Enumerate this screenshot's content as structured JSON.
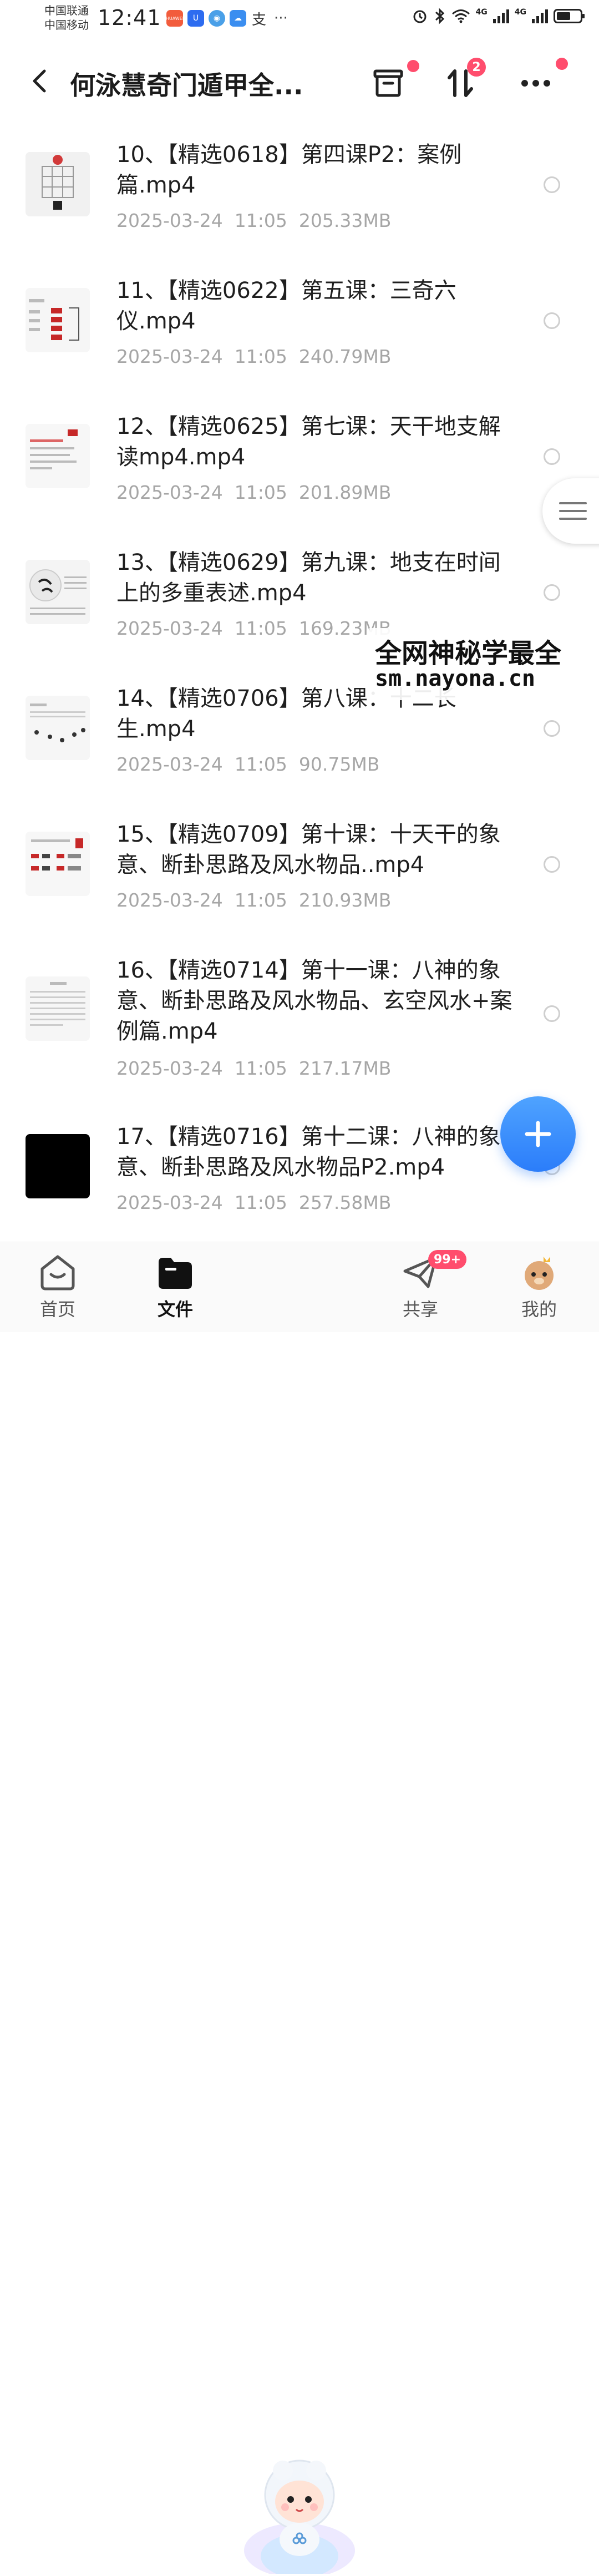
{
  "status_bar": {
    "carrier1": "中国联通",
    "carrier2": "中国移动",
    "time": "12:41",
    "app_badges": [
      "HUAWEI",
      "U",
      "◉",
      "☁",
      "支"
    ],
    "more": "···",
    "net1": "4G",
    "net2": "4G"
  },
  "header": {
    "title": "何泳慧奇门遁甲全...",
    "transfer_badge": "2"
  },
  "files": [
    {
      "name": "10、【精选0618】第四课P2：案例篇.mp4",
      "date": "2025-03-24  11:05",
      "size": "205.33MB"
    },
    {
      "name": "11、【精选0622】第五课：三奇六仪.mp4",
      "date": "2025-03-24  11:05",
      "size": "240.79MB"
    },
    {
      "name": "12、【精选0625】第七课：天干地支解读mp4.mp4",
      "date": "2025-03-24  11:05",
      "size": "201.89MB"
    },
    {
      "name": "13、【精选0629】第九课：地支在时间上的多重表述.mp4",
      "date": "2025-03-24  11:05",
      "size": "169.23MB"
    },
    {
      "name": "14、【精选0706】第八课：十二长生.mp4",
      "date": "2025-03-24  11:05",
      "size": "90.75MB"
    },
    {
      "name": "15、【精选0709】第十课：十天干的象意、断卦思路及风水物品..mp4",
      "date": "2025-03-24  11:05",
      "size": "210.93MB"
    },
    {
      "name": "16、【精选0714】第十一课：八神的象意、断卦思路及风水物品、玄空风水+案例篇.mp4",
      "date": "2025-03-24  11:05",
      "size": "217.17MB"
    },
    {
      "name": "17、【精选0716】第十二课：八神的象意、断卦思路及风水物品P2.mp4",
      "date": "2025-03-24  11:05",
      "size": "257.58MB"
    }
  ],
  "watermark": {
    "line1": "全网神秘学最全",
    "line2": "sm.nayona.cn"
  },
  "nav": {
    "home": "首页",
    "files": "文件",
    "share": "共享",
    "share_badge": "99+",
    "mine": "我的"
  },
  "colors": {
    "accent": "#2b7dfa",
    "badge": "#ff4d6d",
    "meta_text": "#a6a6a6"
  }
}
